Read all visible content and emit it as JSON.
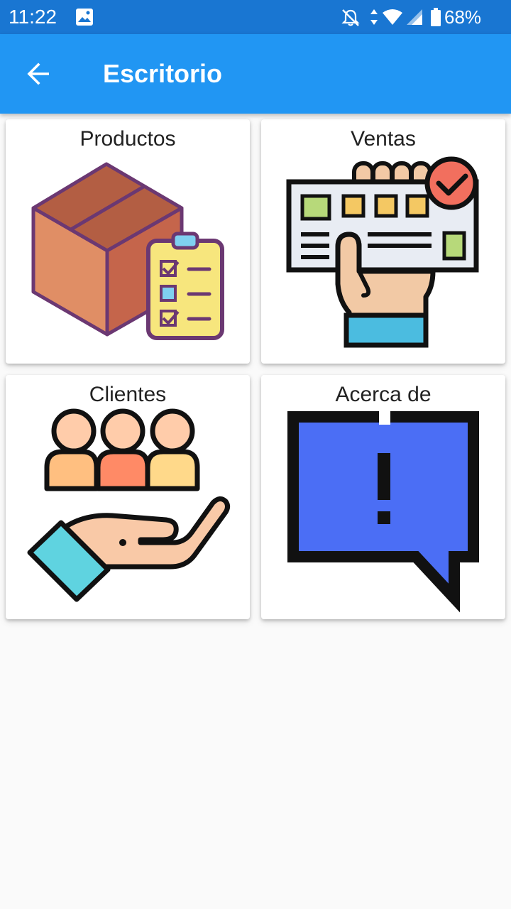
{
  "status_bar": {
    "time": "11:22",
    "battery_percent": "68%",
    "icons": [
      "image-icon",
      "notifications-off-icon",
      "data-arrows-icon",
      "wifi-icon",
      "cell-signal-icon",
      "battery-icon"
    ]
  },
  "app_bar": {
    "title": "Escritorio",
    "back_icon": "arrow-back-icon",
    "color": "#2196f3"
  },
  "cards": [
    {
      "label": "Productos",
      "icon": "box-checklist-icon"
    },
    {
      "label": "Ventas",
      "icon": "hand-receipt-icon"
    },
    {
      "label": "Clientes",
      "icon": "hand-clients-icon"
    },
    {
      "label": "Acerca de",
      "icon": "exclamation-bubble-icon"
    }
  ]
}
